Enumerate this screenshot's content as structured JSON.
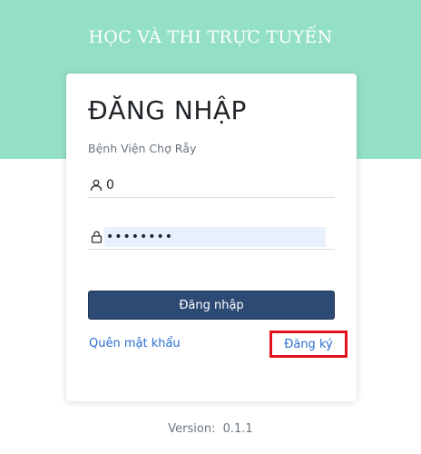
{
  "header": {
    "site_title": "HỌC VÀ THI TRỰC TUYẾN",
    "background_color": "#93e0c4"
  },
  "login_card": {
    "title": "ĐĂNG NHẬP",
    "subtitle": "Bệnh Viện Chợ Rẫy",
    "username": {
      "icon": "user-icon",
      "value": "0"
    },
    "password": {
      "icon": "lock-icon",
      "value": "12345678"
    },
    "login_button_label": "Đăng nhập",
    "login_button_color": "#2d4a74",
    "forgot_password_label": "Quên mật khẩu",
    "register_label": "Đăng ký",
    "link_color": "#2a6fd1",
    "highlight_color": "#e2131b"
  },
  "footer": {
    "version_label": "Version:",
    "version_number": "0.1.1"
  }
}
